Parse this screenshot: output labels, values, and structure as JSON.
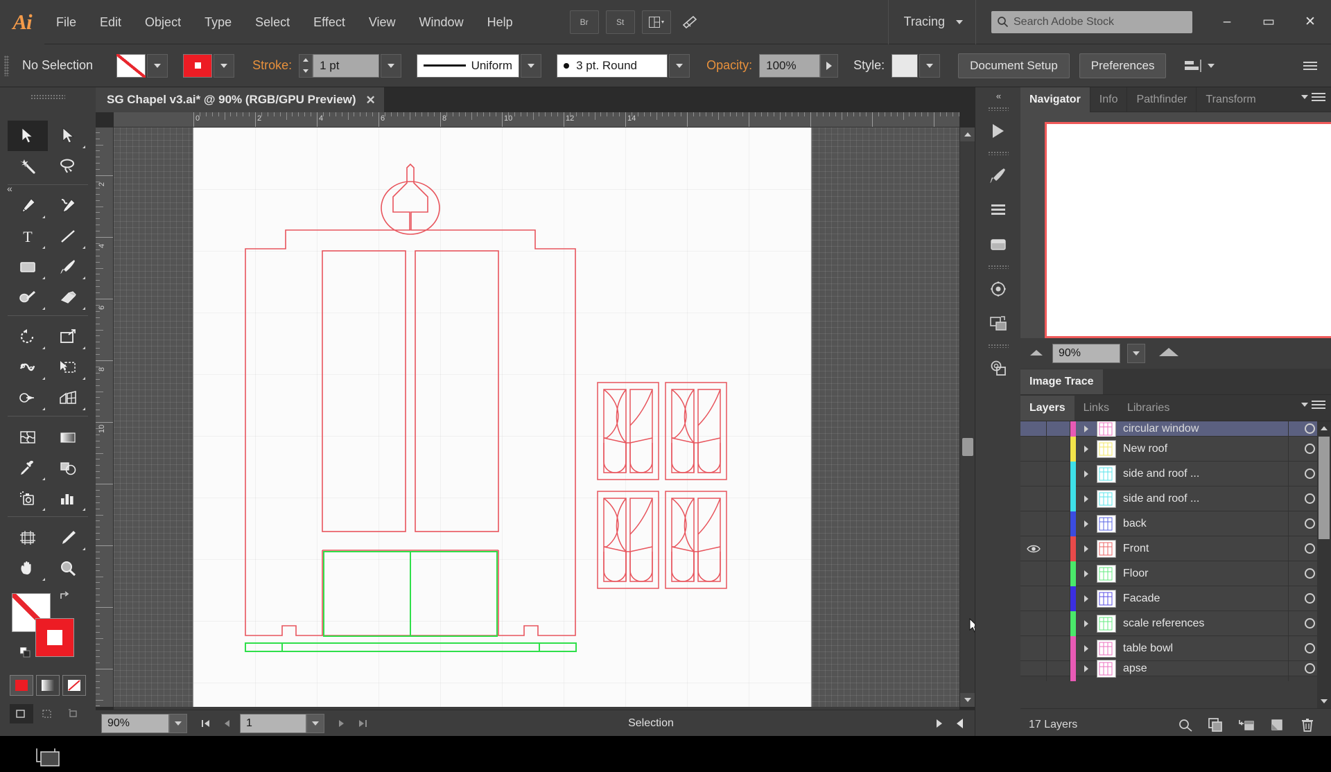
{
  "app": {
    "name": "Adobe Illustrator",
    "logo_text": "Ai"
  },
  "menubar": {
    "items": [
      "File",
      "Edit",
      "Object",
      "Type",
      "Select",
      "Effect",
      "View",
      "Window",
      "Help"
    ],
    "bridge_label": "Br",
    "stock_label": "St",
    "workspace_label": "Tracing",
    "search_placeholder": "Search Adobe Stock",
    "minimize_glyph": "–",
    "maximize_glyph": "▭",
    "close_glyph": "✕"
  },
  "controlbar": {
    "selection_status": "No Selection",
    "fill_swatch_name": "none-fill-swatch",
    "stroke_label": "Stroke:",
    "stroke_weight": "1 pt",
    "stroke_profile": "Uniform",
    "brush_definition": "3 pt. Round",
    "opacity_label": "Opacity:",
    "opacity_value": "100%",
    "style_label": "Style:",
    "document_setup": "Document Setup",
    "preferences": "Preferences"
  },
  "document_tab": {
    "title": "SG Chapel v3.ai* @ 90% (RGB/GPU Preview)",
    "close_glyph": "✕"
  },
  "tools": [
    {
      "name": "selection-tool",
      "glyph": "cursor",
      "selected": true,
      "corner": false
    },
    {
      "name": "direct-selection-tool",
      "glyph": "cursor-white",
      "selected": false,
      "corner": true
    },
    {
      "name": "magic-wand-tool",
      "glyph": "wand",
      "selected": false,
      "corner": false
    },
    {
      "name": "lasso-tool",
      "glyph": "lasso",
      "selected": false,
      "corner": false
    },
    {
      "name": "pen-tool",
      "glyph": "pen",
      "selected": false,
      "corner": true
    },
    {
      "name": "curvature-tool",
      "glyph": "curvature",
      "selected": false,
      "corner": false
    },
    {
      "name": "type-tool",
      "glyph": "type",
      "selected": false,
      "corner": true
    },
    {
      "name": "line-segment-tool",
      "glyph": "line",
      "selected": false,
      "corner": true
    },
    {
      "name": "rectangle-tool",
      "glyph": "rect",
      "selected": false,
      "corner": true
    },
    {
      "name": "paintbrush-tool",
      "glyph": "brush",
      "selected": false,
      "corner": true
    },
    {
      "name": "shaper-tool",
      "glyph": "shaper",
      "selected": false,
      "corner": true
    },
    {
      "name": "eraser-tool",
      "glyph": "eraser",
      "selected": false,
      "corner": true
    },
    {
      "name": "rotate-tool",
      "glyph": "rotate",
      "selected": false,
      "corner": true
    },
    {
      "name": "scale-tool",
      "glyph": "scale",
      "selected": false,
      "corner": true
    },
    {
      "name": "width-tool",
      "glyph": "width",
      "selected": false,
      "corner": true
    },
    {
      "name": "free-transform-tool",
      "glyph": "freetransform",
      "selected": false,
      "corner": true
    },
    {
      "name": "shape-builder-tool",
      "glyph": "shapebuilder",
      "selected": false,
      "corner": true
    },
    {
      "name": "perspective-grid-tool",
      "glyph": "perspective",
      "selected": false,
      "corner": true
    },
    {
      "name": "mesh-tool",
      "glyph": "mesh",
      "selected": false,
      "corner": false
    },
    {
      "name": "gradient-tool",
      "glyph": "gradient",
      "selected": false,
      "corner": false
    },
    {
      "name": "eyedropper-tool",
      "glyph": "eyedropper",
      "selected": false,
      "corner": true
    },
    {
      "name": "blend-tool",
      "glyph": "blend",
      "selected": false,
      "corner": false
    },
    {
      "name": "symbol-sprayer-tool",
      "glyph": "sprayer",
      "selected": false,
      "corner": true
    },
    {
      "name": "column-graph-tool",
      "glyph": "graph",
      "selected": false,
      "corner": true
    },
    {
      "name": "artboard-tool",
      "glyph": "artboard",
      "selected": false,
      "corner": false
    },
    {
      "name": "slice-tool",
      "glyph": "slice",
      "selected": false,
      "corner": true
    },
    {
      "name": "hand-tool",
      "glyph": "hand",
      "selected": false,
      "corner": true
    },
    {
      "name": "zoom-tool",
      "glyph": "zoom",
      "selected": false,
      "corner": false
    }
  ],
  "canvas": {
    "ruler_top_labels": [
      "0",
      "2",
      "4",
      "6",
      "8",
      "10",
      "12",
      "14"
    ],
    "ruler_left_labels": [
      "2",
      "4",
      "6",
      "8",
      "10"
    ],
    "artwork_name": "chapel-facade-line-drawing",
    "stroke_color_red": "#e8545c",
    "stroke_color_green": "#2fdf4a"
  },
  "navigator": {
    "tabs": [
      "Navigator",
      "Info",
      "Pathfinder",
      "Transform"
    ],
    "active_tab": "Navigator",
    "zoom_value": "90%"
  },
  "imagetrace": {
    "tab_label": "Image Trace"
  },
  "layers_panel": {
    "tabs": [
      "Layers",
      "Links",
      "Libraries"
    ],
    "active_tab": "Layers",
    "count_label": "17 Layers",
    "footer_icons": [
      "locate-object-icon",
      "create-sublayer-icon",
      "create-new-layer-icon",
      "duplicate-layer-icon",
      "delete-layer-icon"
    ],
    "rows": [
      {
        "name": "circular window",
        "color": "#e85ab5",
        "visible": false,
        "selected": true,
        "partial": true
      },
      {
        "name": "New roof",
        "color": "#f2e34a",
        "visible": false,
        "selected": false
      },
      {
        "name": "side and roof ...",
        "color": "#3ee0e8",
        "visible": false,
        "selected": false
      },
      {
        "name": "side and roof ...",
        "color": "#3ee0e8",
        "visible": false,
        "selected": false
      },
      {
        "name": "back",
        "color": "#3b4ce0",
        "visible": false,
        "selected": false
      },
      {
        "name": "Front",
        "color": "#e84a4a",
        "visible": true,
        "selected": false
      },
      {
        "name": "Floor",
        "color": "#4ae86a",
        "visible": false,
        "selected": false
      },
      {
        "name": "Facade",
        "color": "#3b2ee0",
        "visible": false,
        "selected": false
      },
      {
        "name": "scale references",
        "color": "#4ae86a",
        "visible": false,
        "selected": false
      },
      {
        "name": "table bowl",
        "color": "#e85ab5",
        "visible": false,
        "selected": false
      },
      {
        "name": "apse",
        "color": "#e85ab5",
        "visible": false,
        "selected": false,
        "partial": true
      }
    ]
  },
  "statusbar": {
    "zoom_value": "90%",
    "page_value": "1",
    "status_text": "Selection",
    "first_glyph": "⏮",
    "prev_glyph": "◀",
    "next_glyph": "▶",
    "last_glyph": "⏭"
  }
}
